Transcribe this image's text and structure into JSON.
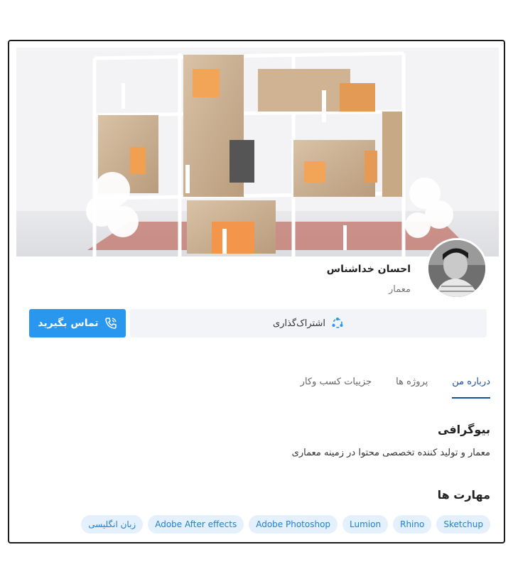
{
  "profile": {
    "name": "احسان خداشناس",
    "role": "معمار"
  },
  "actions": {
    "share_label": "اشتراک‌گذاری",
    "contact_label": "تماس بگیرید"
  },
  "tabs": [
    {
      "label": "درباره من",
      "active": true
    },
    {
      "label": "پروژه ها",
      "active": false
    },
    {
      "label": "جزییات کسب وکار",
      "active": false
    }
  ],
  "bio": {
    "heading": "بیوگرافی",
    "text": "معمار و تولید کننده تخصصی محتوا در زمینه معماری"
  },
  "skills": {
    "heading": "مهارت ها",
    "items": [
      "Sketchup",
      "Rhino",
      "Lumion",
      "Adobe Photoshop",
      "Adobe After effects",
      "زبان انگلیسی"
    ]
  },
  "icons": {
    "share": "share-icon",
    "phone": "phone-icon"
  },
  "colors": {
    "primary": "#2a97ee",
    "tab_active": "#1a4fa0",
    "chip_bg": "#e4f0fc",
    "chip_text": "#1f7fd6"
  }
}
